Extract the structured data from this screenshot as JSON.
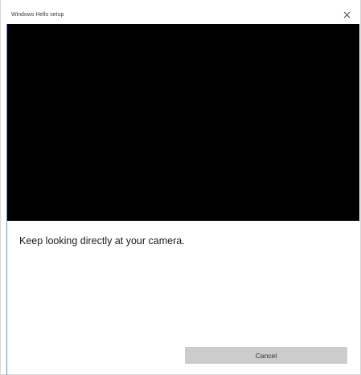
{
  "window": {
    "title": "Windows Hello setup",
    "close_icon": "close-icon"
  },
  "camera": {
    "feed_color": "#000000"
  },
  "main": {
    "instruction": "Keep looking directly at your camera."
  },
  "actions": {
    "cancel_label": "Cancel",
    "cancel_color": "#cccccc"
  }
}
